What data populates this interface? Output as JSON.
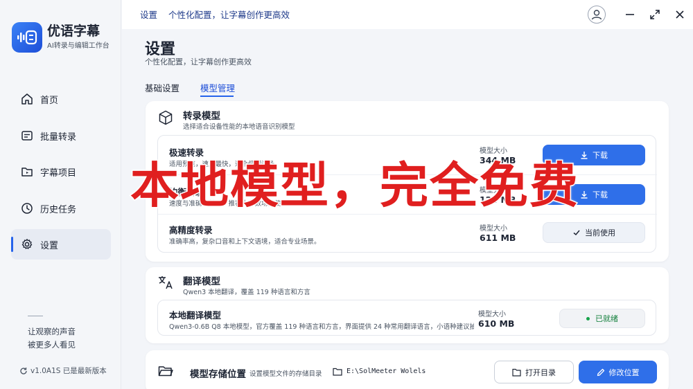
{
  "app": {
    "name": "优语字幕",
    "subtitle": "AI转录与编辑工作台"
  },
  "header": {
    "breadcrumb_section": "设置",
    "breadcrumb_desc": "个性化配置，让字幕创作更高效"
  },
  "sidebar": {
    "items": [
      {
        "label": "首页",
        "icon": "home-icon"
      },
      {
        "label": "批量转录",
        "icon": "batch-icon"
      },
      {
        "label": "字幕项目",
        "icon": "folder-icon"
      },
      {
        "label": "历史任务",
        "icon": "clock-icon"
      },
      {
        "label": "设置",
        "icon": "gear-icon",
        "active": true
      }
    ],
    "slogan_line1": "让观察的声音",
    "slogan_line2": "被更多人看见",
    "version": "v1.0A1S 已是最新版本"
  },
  "page": {
    "title": "设置",
    "subtitle": "个性化配置，让字幕创作更高效",
    "tabs": [
      {
        "label": "基础设置",
        "active": false
      },
      {
        "label": "模型管理",
        "active": true
      }
    ]
  },
  "transcribe": {
    "title": "转录模型",
    "desc": "选择适合设备性能的本地语音识别模型",
    "models": [
      {
        "name": "极速转录",
        "desc": "适用预览，速度最快，适合低配设备",
        "size_label": "模型大小",
        "size": "344 MB",
        "action": "下载"
      },
      {
        "name": "均衡转录",
        "desc": "速度与准确率兼顾，推荐大多数场景使用",
        "size_label": "模型大小",
        "size": "124 MB",
        "action": "下载"
      },
      {
        "name": "高精度转录",
        "desc": "准确率高，复杂口音和上下文语境，适合专业场景。",
        "size_label": "模型大小",
        "size": "611 MB",
        "action": "当前使用"
      }
    ]
  },
  "translate": {
    "title": "翻译模型",
    "desc": "Qwen3 本地翻译，覆盖 119 种语言和方言",
    "model": {
      "name": "本地翻译模型",
      "desc": "Qwen3-0.6B Q8 本地模型，官方覆盖 119 种语言和方言，界面提供 24 种常用翻译语言，小语种建议抽…",
      "size_label": "模型大小",
      "size": "610 MB",
      "status": "已就绪"
    }
  },
  "storage": {
    "title": "模型存储位置",
    "desc": "设置模型文件的存储目录",
    "path": "E:\\SolMeeter Wolels",
    "open_label": "打开目录",
    "change_label": "修改位置"
  },
  "overlay_text": "本地模型，完全免费",
  "colors": {
    "accent": "#2f6fe9",
    "overlay": "#e01f1f",
    "ready": "#15803d"
  }
}
